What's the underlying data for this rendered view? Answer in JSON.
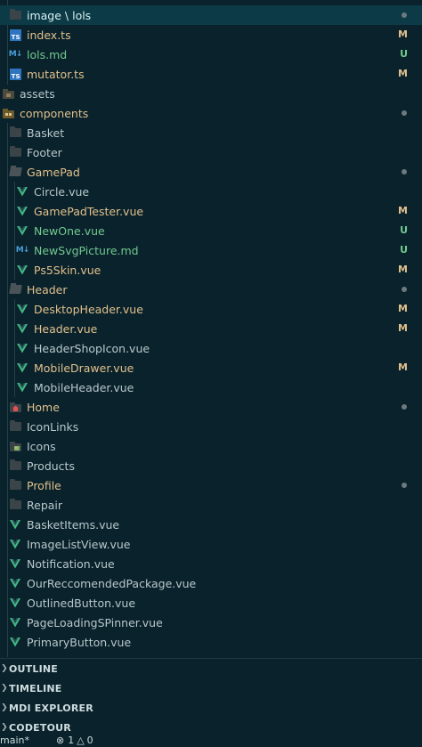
{
  "colors": {
    "background": "#09222b",
    "selected_row": "#0c3a47",
    "modified": "#e2c08d",
    "untracked": "#73c991",
    "typescript": "#2f74c0",
    "vue": "#41b883"
  },
  "explorer": {
    "rows": [
      {
        "label": "image \\ lols",
        "kind": "folder",
        "indent": 1,
        "state": "selected",
        "status": "dot"
      },
      {
        "label": "index.ts",
        "kind": "ts",
        "indent": 1,
        "state": "mod",
        "status": "M"
      },
      {
        "label": "lols.md",
        "kind": "md",
        "indent": 1,
        "state": "new",
        "status": "U"
      },
      {
        "label": "mutator.ts",
        "kind": "ts",
        "indent": 1,
        "state": "mod",
        "status": "M"
      },
      {
        "label": "assets",
        "kind": "folder-special",
        "indent": 0,
        "state": "plain",
        "status": ""
      },
      {
        "label": "components",
        "kind": "folder-open-special",
        "indent": 0,
        "state": "mod",
        "status": "dot"
      },
      {
        "label": "Basket",
        "kind": "folder",
        "indent": 1,
        "state": "plain",
        "status": ""
      },
      {
        "label": "Footer",
        "kind": "folder",
        "indent": 1,
        "state": "plain",
        "status": ""
      },
      {
        "label": "GamePad",
        "kind": "folder-open",
        "indent": 1,
        "state": "mod",
        "status": "dot"
      },
      {
        "label": "Circle.vue",
        "kind": "vue",
        "indent": 2,
        "state": "plain",
        "status": ""
      },
      {
        "label": "GamePadTester.vue",
        "kind": "vue",
        "indent": 2,
        "state": "mod",
        "status": "M"
      },
      {
        "label": "NewOne.vue",
        "kind": "vue",
        "indent": 2,
        "state": "new",
        "status": "U"
      },
      {
        "label": "NewSvgPicture.md",
        "kind": "md",
        "indent": 2,
        "state": "new",
        "status": "U"
      },
      {
        "label": "Ps5Skin.vue",
        "kind": "vue",
        "indent": 2,
        "state": "mod",
        "status": "M"
      },
      {
        "label": "Header",
        "kind": "folder-open",
        "indent": 1,
        "state": "mod",
        "status": "dot"
      },
      {
        "label": "DesktopHeader.vue",
        "kind": "vue",
        "indent": 2,
        "state": "mod",
        "status": "M"
      },
      {
        "label": "Header.vue",
        "kind": "vue",
        "indent": 2,
        "state": "mod",
        "status": "M"
      },
      {
        "label": "HeaderShopIcon.vue",
        "kind": "vue",
        "indent": 2,
        "state": "plain",
        "status": ""
      },
      {
        "label": "MobileDrawer.vue",
        "kind": "vue",
        "indent": 2,
        "state": "mod",
        "status": "M"
      },
      {
        "label": "MobileHeader.vue",
        "kind": "vue",
        "indent": 2,
        "state": "plain",
        "status": ""
      },
      {
        "label": "Home",
        "kind": "folder-home",
        "indent": 1,
        "state": "mod",
        "status": "dot"
      },
      {
        "label": "IconLinks",
        "kind": "folder",
        "indent": 1,
        "state": "plain",
        "status": ""
      },
      {
        "label": "Icons",
        "kind": "folder-image",
        "indent": 1,
        "state": "plain",
        "status": ""
      },
      {
        "label": "Products",
        "kind": "folder",
        "indent": 1,
        "state": "plain",
        "status": ""
      },
      {
        "label": "Profile",
        "kind": "folder",
        "indent": 1,
        "state": "mod",
        "status": "dot"
      },
      {
        "label": "Repair",
        "kind": "folder",
        "indent": 1,
        "state": "plain",
        "status": ""
      },
      {
        "label": "BasketItems.vue",
        "kind": "vue",
        "indent": 1,
        "state": "plain",
        "status": ""
      },
      {
        "label": "ImageListView.vue",
        "kind": "vue",
        "indent": 1,
        "state": "plain",
        "status": ""
      },
      {
        "label": "Notification.vue",
        "kind": "vue",
        "indent": 1,
        "state": "plain",
        "status": ""
      },
      {
        "label": "OurReccomendedPackage.vue",
        "kind": "vue",
        "indent": 1,
        "state": "plain",
        "status": ""
      },
      {
        "label": "OutlinedButton.vue",
        "kind": "vue",
        "indent": 1,
        "state": "plain",
        "status": ""
      },
      {
        "label": "PageLoadingSPinner.vue",
        "kind": "vue",
        "indent": 1,
        "state": "plain",
        "status": ""
      },
      {
        "label": "PrimaryButton.vue",
        "kind": "vue",
        "indent": 1,
        "state": "plain",
        "status": ""
      }
    ]
  },
  "sections": [
    {
      "label": "OUTLINE"
    },
    {
      "label": "TIMELINE"
    },
    {
      "label": "MDI EXPLORER"
    },
    {
      "label": "CODETOUR"
    }
  ],
  "statusbar": {
    "branch": "main*",
    "errors": "1",
    "warnings": "0"
  }
}
